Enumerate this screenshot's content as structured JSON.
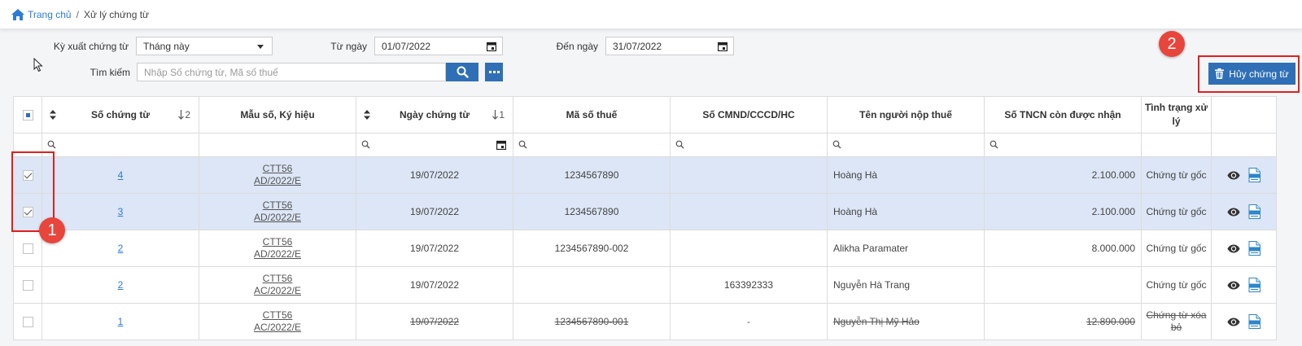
{
  "breadcrumb": {
    "home": "Trang chủ",
    "separator": "/",
    "current": "Xử lý chứng từ"
  },
  "filters": {
    "period_label": "Kỳ xuất chứng từ",
    "period_value": "Tháng này",
    "from_label": "Từ ngày",
    "from_value": "01/07/2022",
    "to_label": "Đến ngày",
    "to_value": "31/07/2022",
    "search_label": "Tìm kiếm",
    "search_placeholder": "Nhập Số chứng từ, Mã số thuế"
  },
  "actions": {
    "cancel_label": "Hủy chứng từ"
  },
  "badges": {
    "one": "1",
    "two": "2"
  },
  "table": {
    "headers": [
      "Số chứng từ",
      "Mẫu số, Ký hiệu",
      "Ngày chứng từ",
      "Mã số thuế",
      "Số CMND/CCCD/HC",
      "Tên người nộp thuế",
      "Số TNCN còn được nhận",
      "Tình trạng xử lý"
    ],
    "sort_so": "2",
    "sort_ngay": "1",
    "rows": [
      {
        "so": "4",
        "mau1": "CTT56",
        "mau2": "AD/2022/E",
        "ngay": "19/07/2022",
        "mst": "1234567890",
        "cmnd": "",
        "ten": "Hoàng Hà",
        "tncn": "2.100.000",
        "tinhtrang": "Chứng từ gốc",
        "checked": true,
        "deleted": false
      },
      {
        "so": "3",
        "mau1": "CTT56",
        "mau2": "AD/2022/E",
        "ngay": "19/07/2022",
        "mst": "1234567890",
        "cmnd": "",
        "ten": "Hoàng Hà",
        "tncn": "2.100.000",
        "tinhtrang": "Chứng từ gốc",
        "checked": true,
        "deleted": false
      },
      {
        "so": "2",
        "mau1": "CTT56",
        "mau2": "AD/2022/E",
        "ngay": "19/07/2022",
        "mst": "1234567890-002",
        "cmnd": "",
        "ten": "Alikha Paramater",
        "tncn": "8.000.000",
        "tinhtrang": "Chứng từ gốc",
        "checked": false,
        "deleted": false
      },
      {
        "so": "2",
        "mau1": "CTT56",
        "mau2": "AC/2022/E",
        "ngay": "19/07/2022",
        "mst": "",
        "cmnd": "163392333",
        "ten": "Nguyễn Hà Trang",
        "tncn": "",
        "tinhtrang": "Chứng từ gốc",
        "checked": false,
        "deleted": false
      },
      {
        "so": "1",
        "mau1": "CTT56",
        "mau2": "AC/2022/E",
        "ngay": "19/07/2022",
        "mst": "1234567890-001",
        "cmnd": "-",
        "ten": "Nguyễn Thị Mỹ Hảo",
        "tncn": "12.890.000",
        "tinhtrang": "Chứng từ xóa bỏ",
        "checked": false,
        "deleted": true
      }
    ]
  },
  "colors": {
    "accent": "#2f6fb6",
    "selected_row": "#dce6f6",
    "highlight": "#e02020"
  },
  "icons": {
    "home": "home-icon",
    "search": "search-icon",
    "calendar": "calendar-icon",
    "trash": "trash-icon",
    "view": "eye-icon",
    "xml": "xml-file-icon"
  }
}
